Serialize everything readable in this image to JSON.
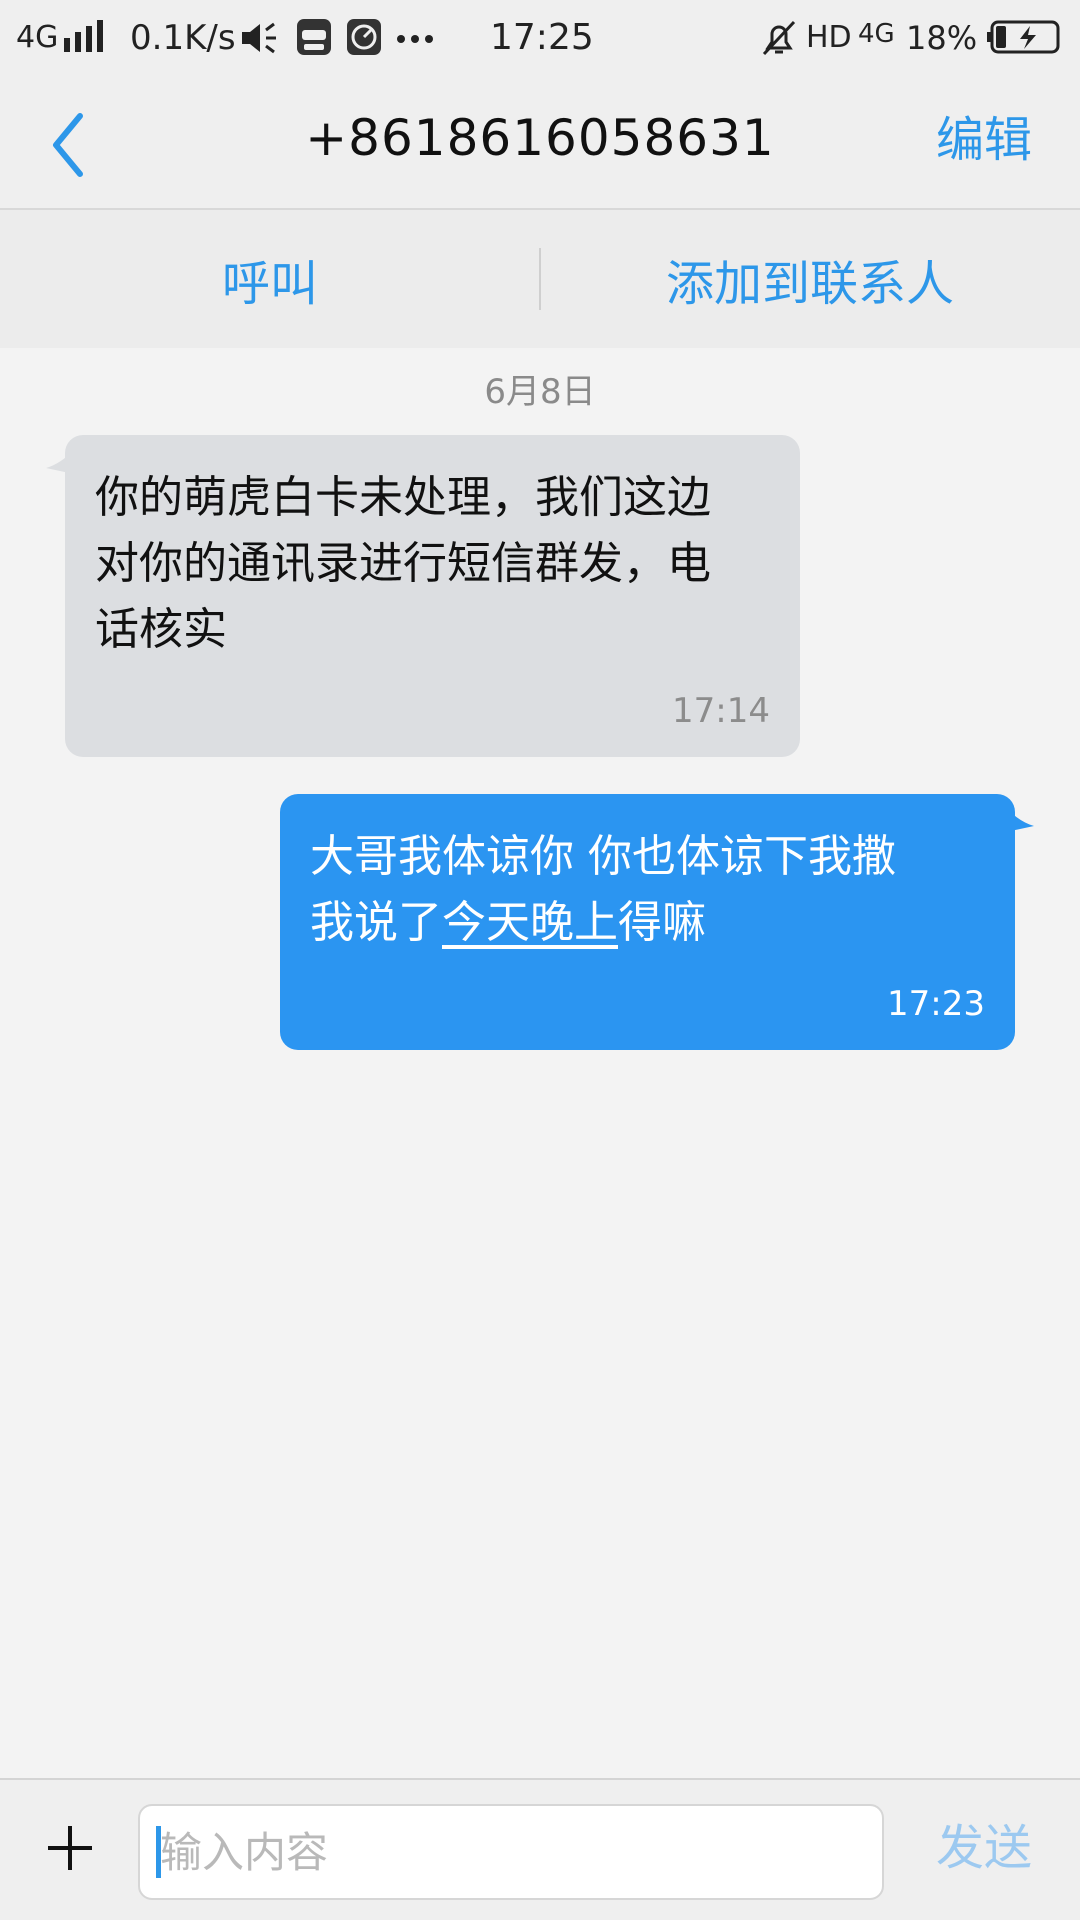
{
  "status_bar": {
    "network_left": "4G",
    "speed": "0.1K/s",
    "time": "17:25",
    "network_right": "HD",
    "network_right_2": "4G",
    "battery": "18%",
    "icons": [
      "signal-bars-icon",
      "speaker-icon",
      "vivo-app-icon",
      "gauge-icon",
      "more-dots-icon",
      "alarm-off-icon",
      "battery-charging-icon"
    ]
  },
  "header": {
    "title": "+8618616058631",
    "edit_label": "编辑",
    "back_icon": "chevron-left-icon"
  },
  "actions": {
    "call_label": "呼叫",
    "add_contact_label": "添加到联系人"
  },
  "messages": {
    "date": "6月8日",
    "incoming": {
      "line1": "你的萌虎白卡未处理，我们这边",
      "line2": "对你的通讯录进行短信群发，电",
      "line3": "话核实",
      "time": "17:14"
    },
    "outgoing": {
      "line1": "大哥我体谅你 你也体谅下我撒",
      "line2_prefix": "我说了",
      "line2_link": "今天晚上",
      "line2_suffix": "得嘛",
      "time": "17:23"
    }
  },
  "composer": {
    "placeholder": "输入内容",
    "send_label": "发送",
    "plus_icon": "plus-icon"
  },
  "colors": {
    "accent": "#2d97e9",
    "outgoing_bubble": "#2b95f1",
    "incoming_bubble": "#dcdee1",
    "send_disabled": "#9cc9f0"
  }
}
